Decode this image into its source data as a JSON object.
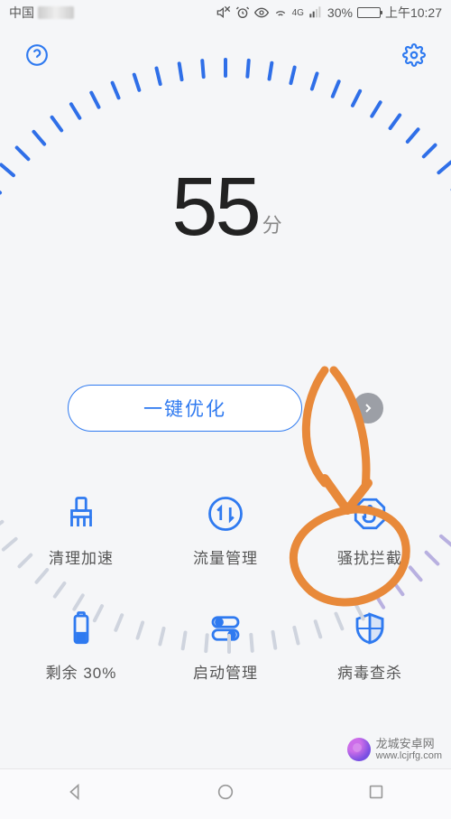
{
  "status_bar": {
    "carrier": "中国",
    "battery_pct": "30%",
    "time": "上午10:27",
    "net_label": "4G"
  },
  "score": {
    "value": "55",
    "unit": "分"
  },
  "optimize_label": "一键优化",
  "grid": [
    {
      "name": "cleanup-boost",
      "label": "清理加速"
    },
    {
      "name": "traffic-manage",
      "label": "流量管理"
    },
    {
      "name": "harass-block",
      "label": "骚扰拦截"
    },
    {
      "name": "battery-remaining",
      "label": "剩余 30%"
    },
    {
      "name": "startup-manage",
      "label": "启动管理"
    },
    {
      "name": "virus-scan",
      "label": "病毒查杀"
    }
  ],
  "watermark": {
    "title": "龙城安卓网",
    "sub": "www.lcjrfg.com"
  },
  "dial": {
    "total_ticks": 80,
    "progress_pct": 55
  },
  "colors": {
    "accent": "#2f7af0",
    "arrow_bg": "#9c9fa6",
    "annotation": "#e8893a"
  }
}
